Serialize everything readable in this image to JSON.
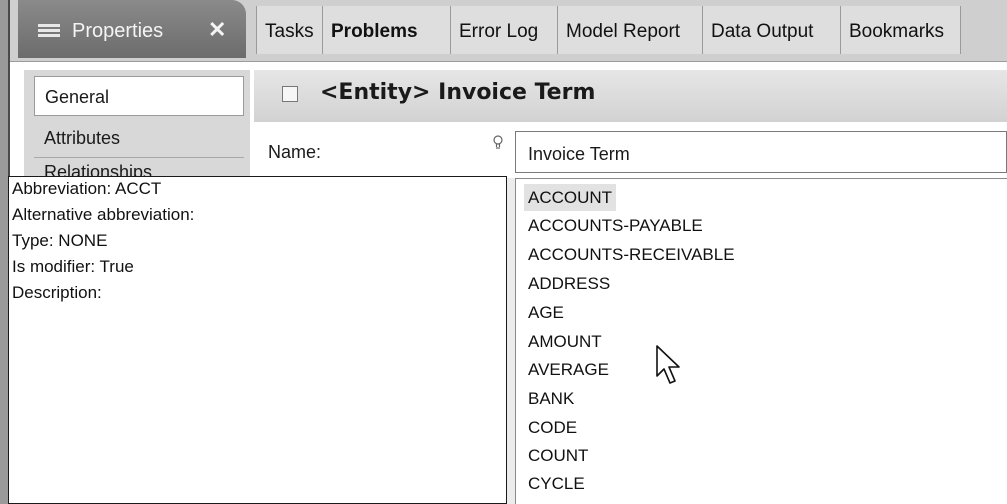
{
  "tabs": {
    "active_label": "Properties",
    "close_glyph": "✕",
    "items": [
      "Tasks",
      "Problems",
      "Error Log",
      "Model Report",
      "Data Output",
      "Bookmarks"
    ]
  },
  "sidebar": {
    "items": [
      {
        "label": "General",
        "selected": true
      },
      {
        "label": "Attributes",
        "selected": false
      },
      {
        "label": "Relationships",
        "selected": false
      }
    ]
  },
  "entity": {
    "title": "<Entity> Invoice Term"
  },
  "name_field": {
    "label": "Name:",
    "value": "Invoice Term"
  },
  "dropdown": {
    "selected_index": 0,
    "options": [
      "ACCOUNT",
      "ACCOUNTS-PAYABLE",
      "ACCOUNTS-RECEIVABLE",
      "ADDRESS",
      "AGE",
      "AMOUNT",
      "AVERAGE",
      "BANK",
      "CODE",
      "COUNT",
      "CYCLE"
    ]
  },
  "tooltip": {
    "lines": [
      "Abbreviation: ACCT",
      "Alternative abbreviation:",
      "Type: NONE",
      "Is modifier: True",
      "Description:"
    ]
  },
  "icons": {
    "tab_icon": "properties-list-icon",
    "hint_icon": "lightbulb-icon",
    "cursor": "mouse-pointer-icon"
  }
}
